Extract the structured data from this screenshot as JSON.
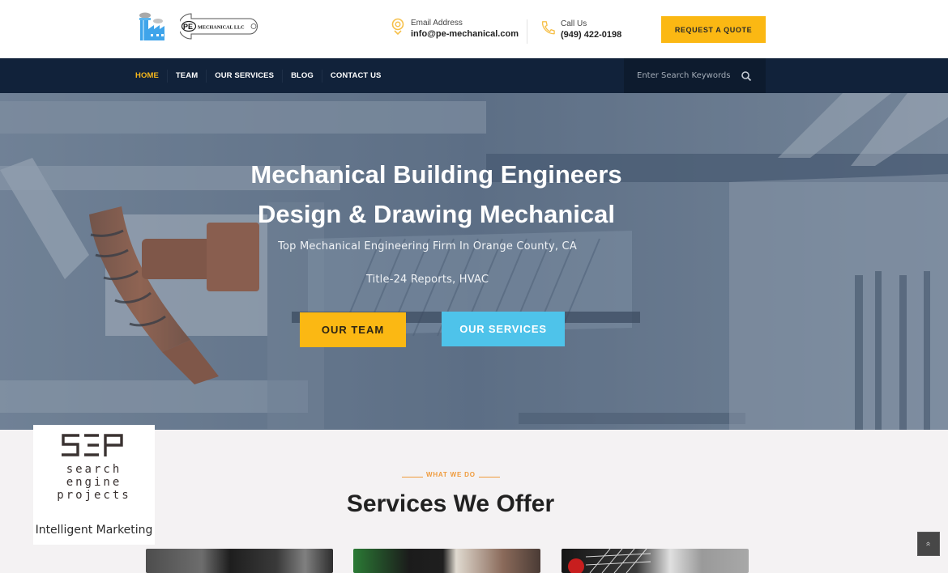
{
  "header": {
    "brand_name": "PE MECHANICAL LLC",
    "brand_initials": "PE",
    "brand_text": "MECHANICAL LLC",
    "email_label": "Email Address",
    "email_value": "info@pe-mechanical.com",
    "phone_label": "Call Us",
    "phone_value": "(949) 422-0198",
    "quote_button": "REQUEST A QUOTE"
  },
  "nav": {
    "items": [
      {
        "label": "HOME",
        "active": true
      },
      {
        "label": "TEAM",
        "active": false
      },
      {
        "label": "OUR SERVICES",
        "active": false
      },
      {
        "label": "BLOG",
        "active": false
      },
      {
        "label": "CONTACT US",
        "active": false
      }
    ],
    "search_placeholder": "Enter Search Keywords"
  },
  "hero": {
    "title_line1": "Mechanical Building Engineers",
    "title_line2": "Design & Drawing Mechanical",
    "subtitle1": "Top Mechanical Engineering Firm In Orange County, CA",
    "subtitle2": "Title-24 Reports, HVAC",
    "team_button": "OUR TEAM",
    "services_button": "OUR SERVICES"
  },
  "services_section": {
    "kicker": "WHAT WE DO",
    "title": "Services We Offer"
  },
  "sep_badge": {
    "logo": "SEP",
    "words": [
      "search",
      "engine",
      "projects"
    ],
    "tagline": "Intelligent Marketing"
  },
  "scroll_top_icon": "»",
  "colors": {
    "accent_yellow": "#fbb813",
    "accent_blue": "#4ec3ea",
    "nav_bg": "#11223a",
    "kicker_orange": "#ef9b3c"
  }
}
